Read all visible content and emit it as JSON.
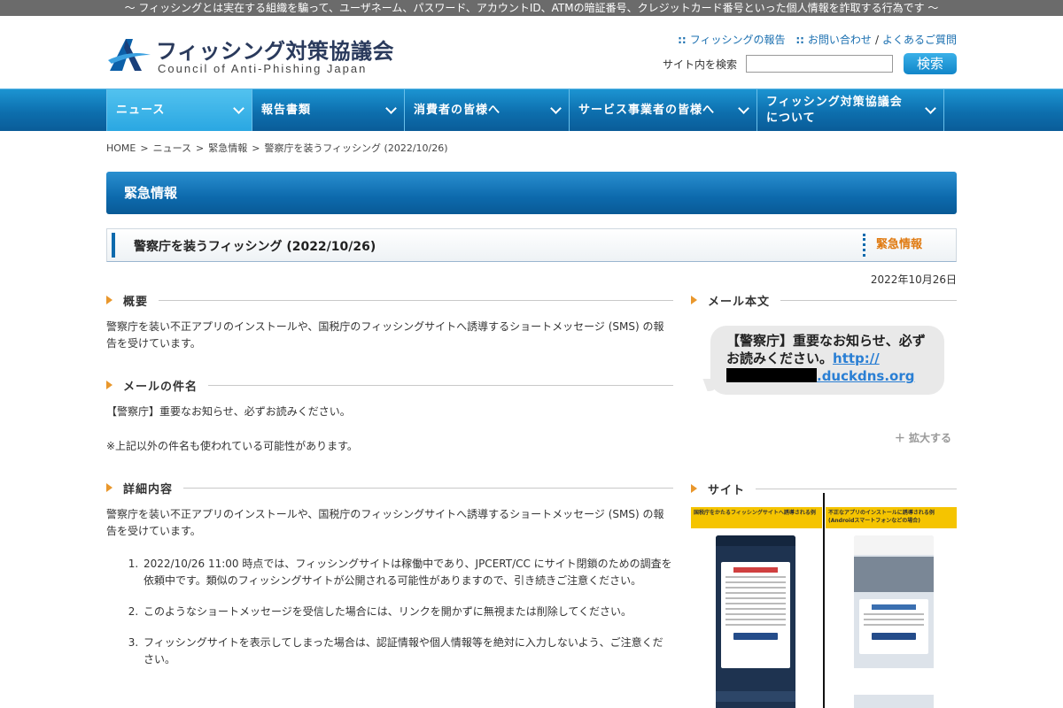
{
  "top_strip": "～ フィッシングとは実在する組織を騙って、ユーザネーム、パスワード、アカウントID、ATMの暗証番号、クレジットカード番号といった個人情報を詐取する行為です ～",
  "header": {
    "logo_jp": "フィッシング対策協議会",
    "logo_en": "Council of Anti-Phishing Japan",
    "links": {
      "reports": "フィッシングの報告",
      "contact": "お問い合わせ",
      "faq": "よくあるご質問"
    },
    "search_label": "サイト内を検索",
    "search_value": "",
    "search_button": "検索"
  },
  "nav": [
    {
      "label": "ニュース"
    },
    {
      "label": "報告書類"
    },
    {
      "label": "消費者の皆様へ"
    },
    {
      "label": "サービス事業者の皆様へ"
    },
    {
      "label": "フィッシング対策協議会について"
    }
  ],
  "breadcrumb": [
    "HOME",
    "ニュース",
    "緊急情報",
    "警察庁を装うフィッシング (2022/10/26)"
  ],
  "section_title": "緊急情報",
  "article": {
    "title": "警察庁を装うフィッシング (2022/10/26)",
    "tag": "緊急情報",
    "date": "2022年10月26日"
  },
  "left": {
    "overview_heading": "概要",
    "overview_text": "警察庁を装い不正アプリのインストールや、国税庁のフィッシングサイトへ誘導するショートメッセージ (SMS) の報告を受けています。",
    "subject_heading": "メールの件名",
    "subject_text": "【警察庁】重要なお知らせ、必ずお読みください。",
    "subject_note": "※上記以外の件名も使われている可能性があります。",
    "details_heading": "詳細内容",
    "details_text": "警察庁を装い不正アプリのインストールや、国税庁のフィッシングサイトへ誘導するショートメッセージ (SMS) の報告を受けています。",
    "details_items": [
      "2022/10/26 11:00 時点では、フィッシングサイトは稼働中であり、JPCERT/CC にサイト閉鎖のための調査を依頼中です。類似のフィッシングサイトが公開される可能性がありますので、引き続きご注意ください。",
      "このようなショートメッセージを受信した場合には、リンクを開かずに無視または削除してください。",
      "フィッシングサイトを表示してしまった場合は、認証情報や個人情報等を絶対に入力しないよう、ご注意ください。"
    ]
  },
  "right": {
    "mail_heading": "メール本文",
    "sms_text": "【警察庁】重要なお知らせ、必ずお読みください。",
    "sms_link_a": "http://",
    "sms_link_b": ".duckdns.org",
    "enlarge": "＋ 拡大する",
    "site_heading": "サイト",
    "site_left_caption": "国税庁をかたるフィッシングサイトへ誘導される例",
    "site_right_caption": "不正なアプリのインストールに誘導される例",
    "site_right_caption_sub": "(Androidスマートフォンなどの場合)",
    "colors": {
      "accent": "#0d6aad",
      "orange": "#e9972c",
      "tag": "#e07b12",
      "yellow": "#f5c400"
    }
  }
}
